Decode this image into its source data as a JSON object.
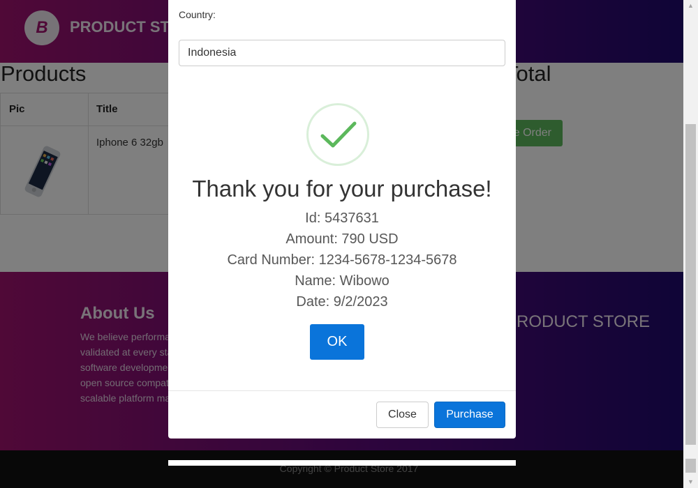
{
  "navbar": {
    "brand": "PRODUCT STORE",
    "logo_letter": "B"
  },
  "cart": {
    "heading": "Products",
    "total_heading": "Total",
    "columns": [
      "Pic",
      "Title"
    ],
    "rows": [
      {
        "title": "Iphone 6 32gb"
      }
    ],
    "place_order_label": "Place Order"
  },
  "footer": {
    "about_title": "About Us",
    "about_text": "We believe performance needs to be validated at every stage of the software development cycle and our open source compatible, massively scalable platform makes that a reality.",
    "brand": "PRODUCT STORE",
    "copyright": "Copyright © Product Store 2017"
  },
  "order_modal": {
    "country_label": "Country:",
    "country_value": "Indonesia",
    "close_label": "Close",
    "purchase_label": "Purchase"
  },
  "alert": {
    "title": "Thank you for your purchase!",
    "id_line": "Id: 5437631",
    "amount_line": "Amount: 790 USD",
    "card_line": "Card Number: 1234-5678-1234-5678",
    "name_line": "Name: Wibowo",
    "date_line": "Date: 9/2/2023",
    "ok_label": "OK"
  },
  "icons": {
    "success": "check-icon",
    "logo": "logo-icon",
    "scroll_up": "scroll-up-arrow-icon",
    "scroll_down": "scroll-down-arrow-icon"
  },
  "colors": {
    "brand_gradient_start": "#a0126f",
    "brand_gradient_end": "#1f0a6e",
    "primary_button": "#0a74da",
    "success_green": "#5cb85c",
    "check_green": "#5cb85c"
  }
}
